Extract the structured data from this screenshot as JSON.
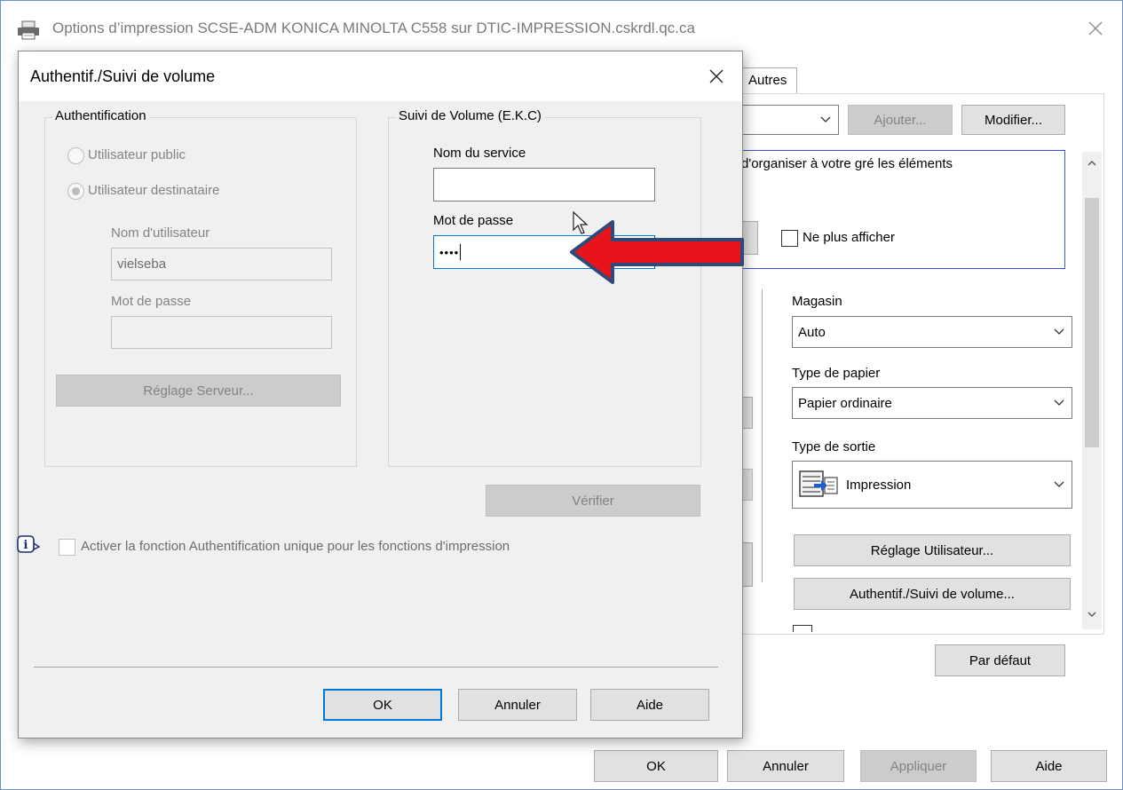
{
  "main_window": {
    "title": "Options d’impression SCSE-ADM KONICA MINOLTA C558 sur DTIC-IMPRESSION.cskrdl.qc.ca",
    "tab_label": "Autres",
    "add_button": "Ajouter...",
    "modify_button": "Modifier...",
    "message_text": "d'organiser à votre gré les éléments",
    "dont_show_label": "Ne plus afficher",
    "magasin_label": "Magasin",
    "magasin_value": "Auto",
    "paper_type_label": "Type de papier",
    "paper_type_value": "Papier ordinaire",
    "output_type_label": "Type de sortie",
    "output_type_value": "Impression",
    "user_settings_button": "Réglage Utilisateur...",
    "auth_tracking_button": "Authentif./Suivi de volume...",
    "default_button": "Par défaut",
    "ok_button": "OK",
    "cancel_button": "Annuler",
    "apply_button": "Appliquer",
    "help_button": "Aide"
  },
  "dialog": {
    "title": "Authentif./Suivi de volume",
    "auth_group": {
      "legend": "Authentification",
      "public_user_label": "Utilisateur public",
      "recipient_user_label": "Utilisateur destinataire",
      "username_label": "Nom d'utilisateur",
      "username_value": "vielseba",
      "password_label": "Mot de passe",
      "password_value": "",
      "server_settings_button": "Réglage Serveur..."
    },
    "tracking_group": {
      "legend": "Suivi de Volume (E.K.C)",
      "department_name_label": "Nom du service",
      "department_name_value": "",
      "password_label": "Mot de passe",
      "password_value": "••••"
    },
    "verify_button": "Vérifier",
    "single_sign_on_label": "Activer la fonction Authentification unique pour les fonctions d'impression",
    "ok_button": "OK",
    "cancel_button": "Annuler",
    "help_button": "Aide"
  },
  "colors": {
    "accent": "#0078d7",
    "arrow_fill": "#e8141b",
    "arrow_stroke": "#2f4a78"
  },
  "icons": [
    "printer-icon",
    "close-icon",
    "chevron-down-icon",
    "info-icon",
    "output-tray-icon",
    "arrow-icon",
    "mouse-cursor-icon"
  ]
}
